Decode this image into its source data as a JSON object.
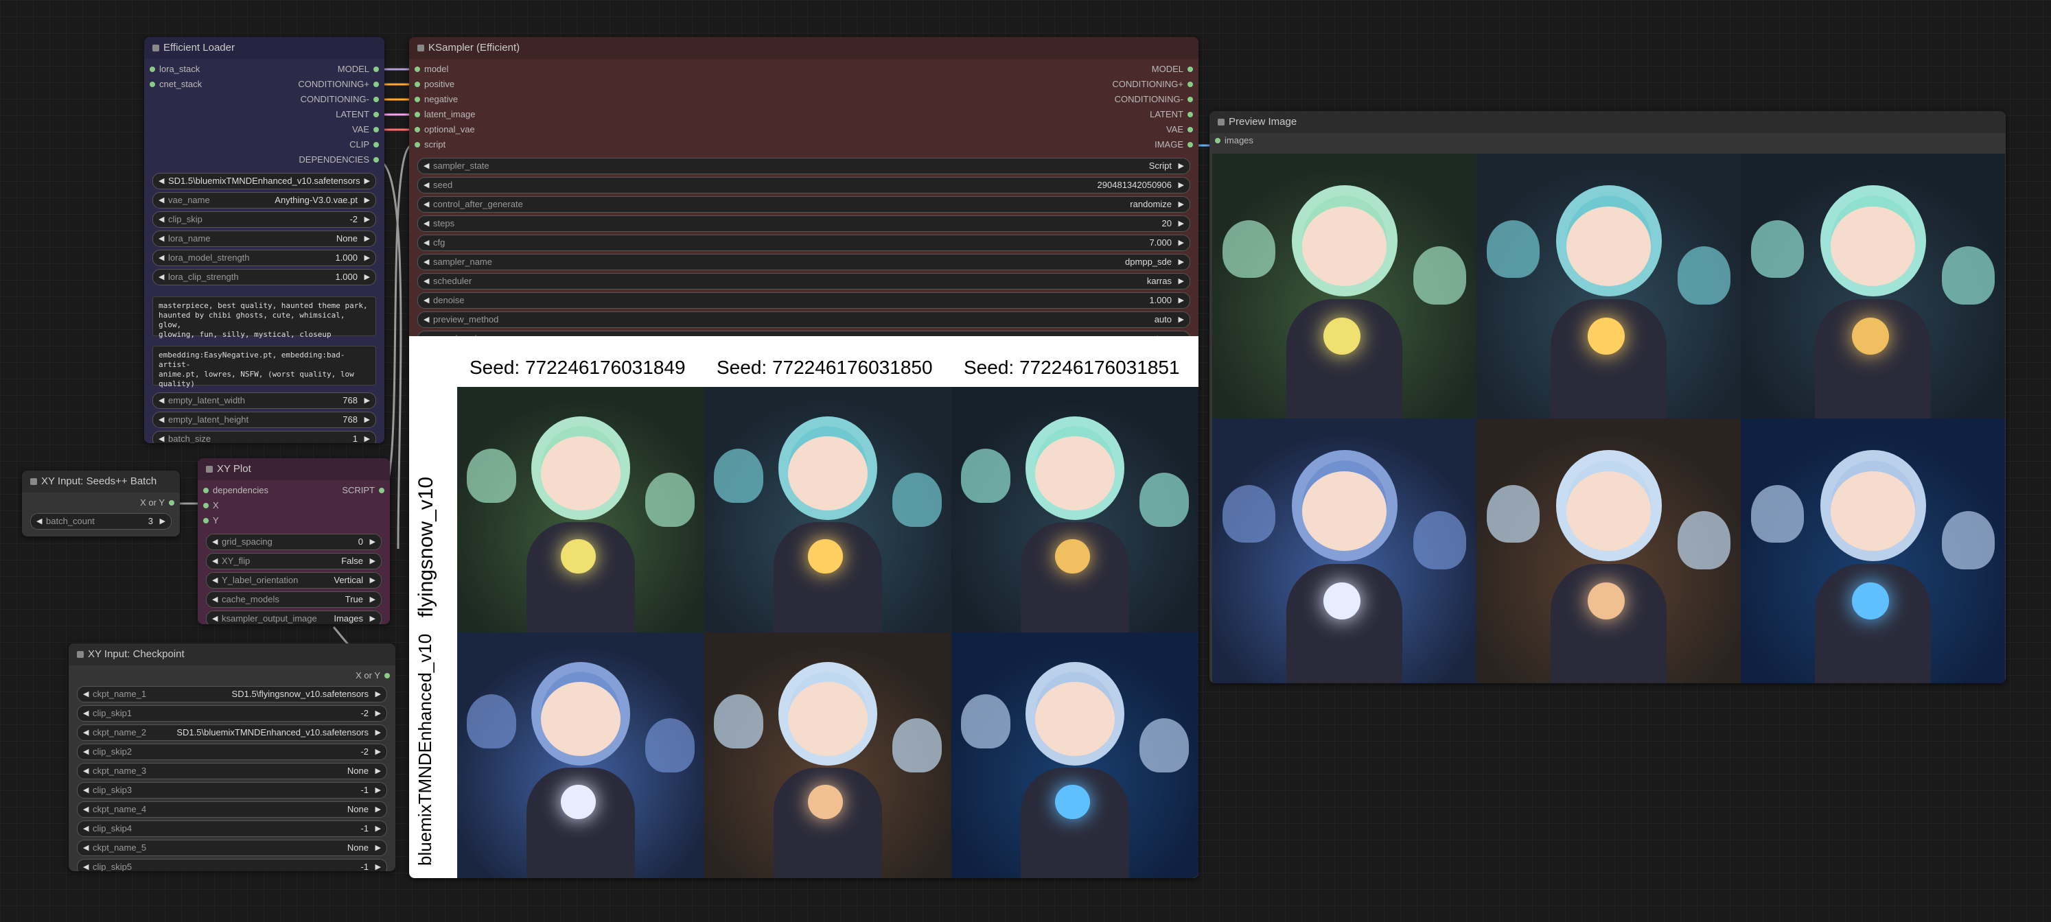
{
  "efficient_loader": {
    "title": "Efficient Loader",
    "inputs": [
      "lora_stack",
      "cnet_stack"
    ],
    "outputs": [
      "MODEL",
      "CONDITIONING+",
      "CONDITIONING-",
      "LATENT",
      "VAE",
      "CLIP",
      "DEPENDENCIES"
    ],
    "widgets": [
      {
        "name": "SD1.5\\bluemixTMNDEnhanced_v10.safetensors",
        "value": ""
      },
      {
        "name": "vae_name",
        "value": "Anything-V3.0.vae.pt"
      },
      {
        "name": "clip_skip",
        "value": "-2"
      },
      {
        "name": "lora_name",
        "value": "None"
      },
      {
        "name": "lora_model_strength",
        "value": "1.000"
      },
      {
        "name": "lora_clip_strength",
        "value": "1.000"
      }
    ],
    "positive": "masterpiece, best quality, haunted theme park,\nhaunted by chibi ghosts, cute, whimsical, glow,\nglowing, fun, silly, mystical, closeup",
    "negative": "embedding:EasyNegative.pt, embedding:bad-artist-\nanime.pt, lowres, NSFW, (worst quality, low quality)",
    "widgets2": [
      {
        "name": "empty_latent_width",
        "value": "768"
      },
      {
        "name": "empty_latent_height",
        "value": "768"
      },
      {
        "name": "batch_size",
        "value": "1"
      }
    ]
  },
  "ksampler": {
    "title": "KSampler (Efficient)",
    "inputs": [
      "model",
      "positive",
      "negative",
      "latent_image",
      "optional_vae",
      "script"
    ],
    "outputs": [
      "MODEL",
      "CONDITIONING+",
      "CONDITIONING-",
      "LATENT",
      "VAE",
      "IMAGE"
    ],
    "widgets": [
      {
        "name": "sampler_state",
        "value": "Script"
      },
      {
        "name": "seed",
        "value": "290481342050906"
      },
      {
        "name": "control_after_generate",
        "value": "randomize"
      },
      {
        "name": "steps",
        "value": "20"
      },
      {
        "name": "cfg",
        "value": "7.000"
      },
      {
        "name": "sampler_name",
        "value": "dpmpp_sde"
      },
      {
        "name": "scheduler",
        "value": "karras"
      },
      {
        "name": "denoise",
        "value": "1.000"
      },
      {
        "name": "preview_method",
        "value": "auto"
      },
      {
        "name": "vae_decode",
        "value": "true"
      }
    ]
  },
  "xy_plot_image": {
    "col_labels": [
      "Seed: 772246176031849",
      "Seed: 772246176031850",
      "Seed: 772246176031851"
    ],
    "row_labels": [
      "flyingsnow_v10",
      "bluemixTMNDEnhanced_v10"
    ]
  },
  "seeds_batch": {
    "title": "XY Input: Seeds++ Batch",
    "output": "X or Y",
    "widgets": [
      {
        "name": "batch_count",
        "value": "3"
      }
    ]
  },
  "xy_plot": {
    "title": "XY Plot",
    "inputs": [
      "dependencies",
      "X",
      "Y"
    ],
    "outputs": [
      "SCRIPT"
    ],
    "widgets": [
      {
        "name": "grid_spacing",
        "value": "0"
      },
      {
        "name": "XY_flip",
        "value": "False"
      },
      {
        "name": "Y_label_orientation",
        "value": "Vertical"
      },
      {
        "name": "cache_models",
        "value": "True"
      },
      {
        "name": "ksampler_output_image",
        "value": "Images"
      }
    ]
  },
  "checkpoint": {
    "title": "XY Input: Checkpoint",
    "output": "X or Y",
    "widgets": [
      {
        "name": "ckpt_name_1",
        "value": "SD1.5\\flyingsnow_v10.safetensors"
      },
      {
        "name": "clip_skip1",
        "value": "-2"
      },
      {
        "name": "ckpt_name_2",
        "value": "SD1.5\\bluemixTMNDEnhanced_v10.safetensors"
      },
      {
        "name": "clip_skip2",
        "value": "-2"
      },
      {
        "name": "ckpt_name_3",
        "value": "None"
      },
      {
        "name": "clip_skip3",
        "value": "-1"
      },
      {
        "name": "ckpt_name_4",
        "value": "None"
      },
      {
        "name": "clip_skip4",
        "value": "-1"
      },
      {
        "name": "ckpt_name_5",
        "value": "None"
      },
      {
        "name": "clip_skip5",
        "value": "-1"
      }
    ]
  },
  "preview": {
    "title": "Preview Image",
    "inputs": [
      "images"
    ]
  },
  "colors": {
    "model": "#b39ddb",
    "cond": "#ffa931",
    "latent": "#ff9cf9",
    "vae": "#ff6e6e",
    "clip": "#ffd500",
    "deps": "#8c8",
    "image": "#64b5f6"
  }
}
